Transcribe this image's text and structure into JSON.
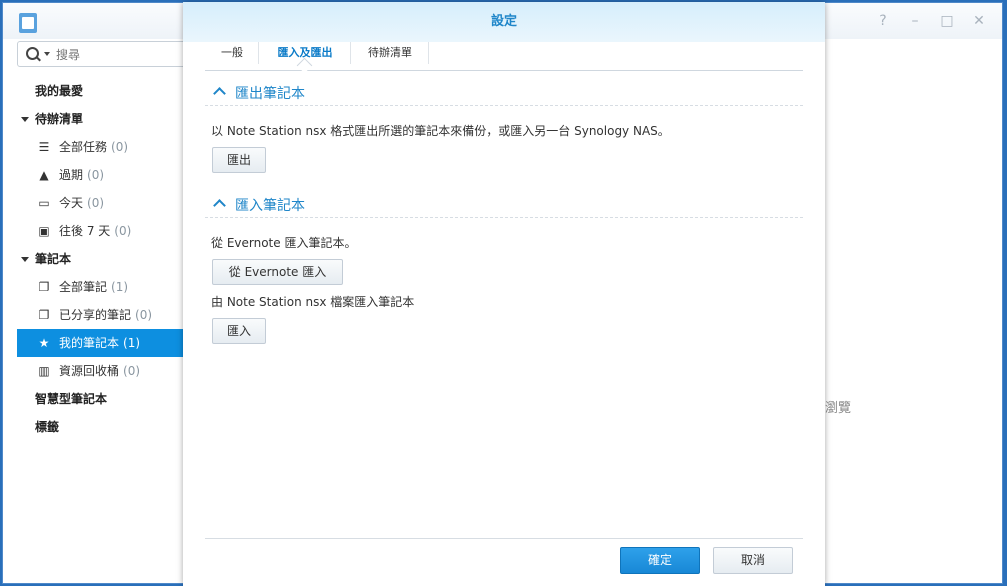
{
  "app": {
    "search_placeholder": "搜尋",
    "background_fragment": "瀏覽"
  },
  "sidebar": {
    "favorites": "我的最愛",
    "todo_section": "待辦清單",
    "todo_items": [
      {
        "label": "全部任務",
        "count": "(0)",
        "icon": "checklist-icon"
      },
      {
        "label": "過期",
        "count": "(0)",
        "icon": "warning-icon"
      },
      {
        "label": "今天",
        "count": "(0)",
        "icon": "calendar-icon"
      },
      {
        "label": "往後 7 天",
        "count": "(0)",
        "icon": "calendar-week-icon"
      }
    ],
    "notebook_section": "筆記本",
    "notebook_items": [
      {
        "label": "全部筆記",
        "count": "(1)",
        "icon": "notes-icon"
      },
      {
        "label": "已分享的筆記",
        "count": "(0)",
        "icon": "shared-notes-icon"
      },
      {
        "label": "我的筆記本",
        "count": "(1)",
        "icon": "notebook-star-icon"
      },
      {
        "label": "資源回收桶",
        "count": "(0)",
        "icon": "trash-icon"
      }
    ],
    "smart_notebooks": "智慧型筆記本",
    "tags": "標籤"
  },
  "dialog": {
    "title": "設定",
    "tabs": [
      "一般",
      "匯入及匯出",
      "待辦清單"
    ],
    "active_tab": "匯入及匯出",
    "export_section": {
      "title": "匯出筆記本",
      "description": "以 Note Station nsx 格式匯出所選的筆記本來備份，或匯入另一台 Synology NAS。",
      "button": "匯出"
    },
    "import_section": {
      "title": "匯入筆記本",
      "evernote_description": "從 Evernote 匯入筆記本。",
      "evernote_button": "從 Evernote 匯入",
      "nsx_description": "由 Note Station nsx 檔案匯入筆記本",
      "nsx_button": "匯入"
    },
    "ok_button": "確定",
    "cancel_button": "取消"
  },
  "colors": {
    "accent": "#1f86c9",
    "selected": "#0d8fe0",
    "primary_button": "#1888d6"
  }
}
